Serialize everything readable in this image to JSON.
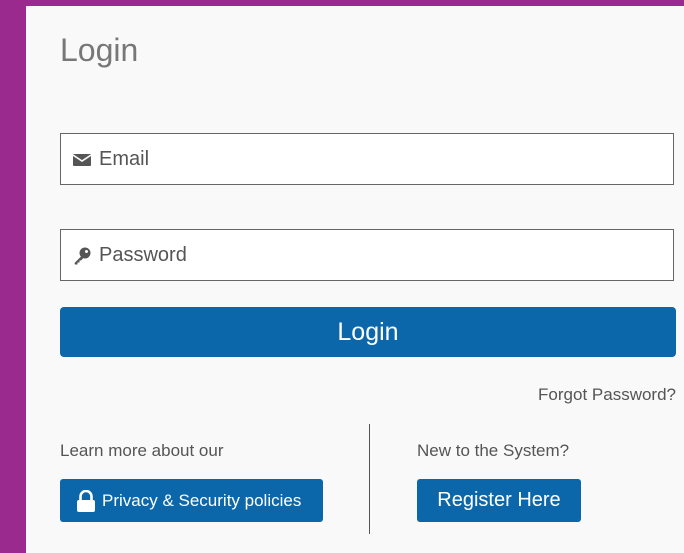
{
  "login_form": {
    "title": "Login",
    "email": {
      "placeholder": "Email",
      "value": "",
      "icon": "envelope-icon"
    },
    "password": {
      "placeholder": "Password",
      "value": "",
      "icon": "key-icon"
    },
    "submit_label": "Login",
    "forgot_password": "Forgot Password?"
  },
  "footer": {
    "learn_more_text": "Learn more about our",
    "privacy_button": {
      "label": "Privacy & Security policies",
      "icon": "lock-icon"
    },
    "new_user_text": "New to the System?",
    "register_button_label": "Register Here"
  },
  "colors": {
    "background": "#9b2a8e",
    "card": "#f9f9f9",
    "primary": "#0b67a9",
    "text_muted": "#555555"
  }
}
